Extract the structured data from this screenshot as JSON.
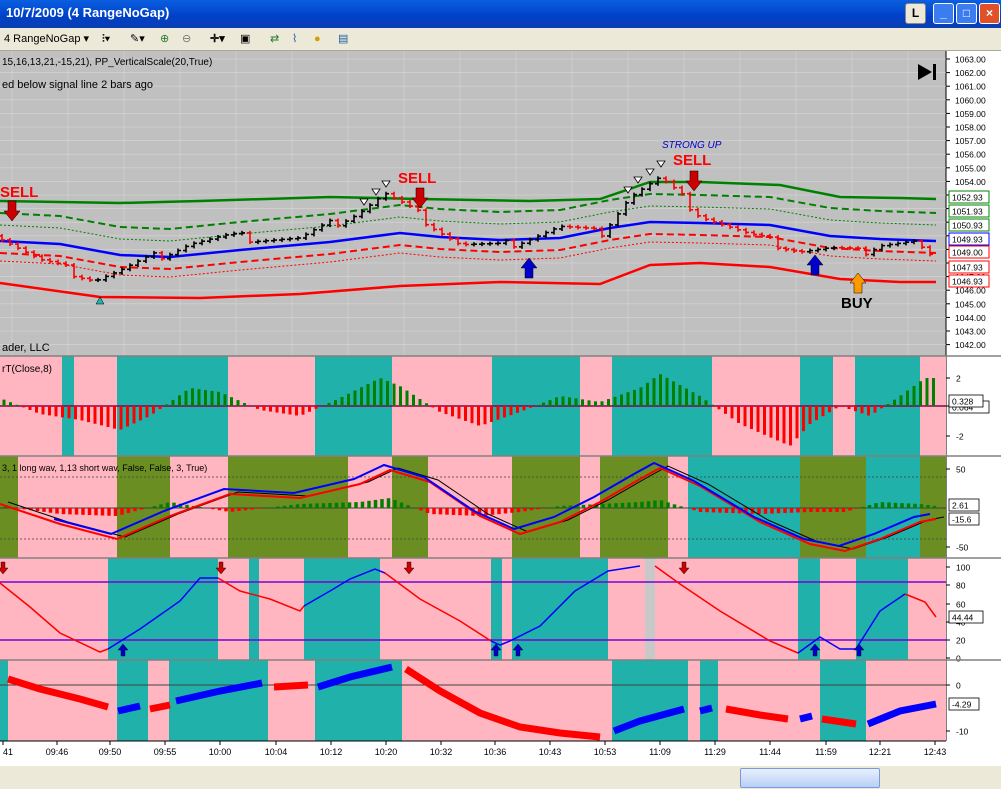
{
  "window": {
    "title": "10/7/2009 (4 RangeNoGap)",
    "buttons": [
      "L",
      "_",
      "□",
      "×"
    ]
  },
  "toolbar": {
    "instrument": "4 RangeNoGap"
  },
  "chart": {
    "indicator_header": "15,16,13,21,-15,21),  PP_VerticalScale(20,True)",
    "alert_text": "ed below signal line  2 bars ago",
    "copyright": "ader, LLC",
    "panel2_label": "rT(Close,8)",
    "panel3_label": "3, 1 long wav, 1,13 short wav, False, False, 3, True)",
    "labels": {
      "sell_left": "SELL",
      "sell_mid": "SELL",
      "sell_right": "SELL",
      "strong_up": "STRONG UP",
      "buy": "BUY"
    },
    "price_axis": [
      "1063.00",
      "1062.00",
      "1061.00",
      "1060.00",
      "1059.00",
      "1058.00",
      "1057.00",
      "1056.00",
      "1055.00",
      "1054.00",
      "1053.00",
      "1052.00",
      "1051.00",
      "1050.00",
      "1049.00",
      "1048.00",
      "1047.00",
      "1046.00",
      "1045.00",
      "1044.00",
      "1043.00",
      "1042.00"
    ],
    "price_tags": [
      "1052.93",
      "1051.93",
      "1050.93",
      "1049.93",
      "1049.00",
      "1047.93",
      "1046.93"
    ],
    "panel2_axis": [
      "2",
      "0",
      "-2"
    ],
    "panel2_tag": "0.328",
    "panel2_tag2": "0.064",
    "panel3_axis": [
      "50",
      "-50"
    ],
    "panel3_tags": [
      "2.61",
      "-15.6"
    ],
    "panel4_axis": [
      "100",
      "80",
      "60",
      "40",
      "20",
      "0"
    ],
    "panel4_tag": "44.44",
    "panel5_axis": [
      "0",
      "-10"
    ],
    "panel5_tag": "-4.29",
    "time_axis": [
      "41",
      "09:46",
      "09:50",
      "09:55",
      "10:00",
      "10:04",
      "10:12",
      "10:20",
      "10:32",
      "10:36",
      "10:43",
      "10:53",
      "11:09",
      "11:29",
      "11:44",
      "11:59",
      "12:21",
      "12:43"
    ]
  },
  "colors": {
    "price_bg": "#c0c0c0",
    "teal": "#20b2aa",
    "pink": "#ffb6c1",
    "olive": "#6b8e23",
    "up": "#008000",
    "down": "#ff0000"
  }
}
